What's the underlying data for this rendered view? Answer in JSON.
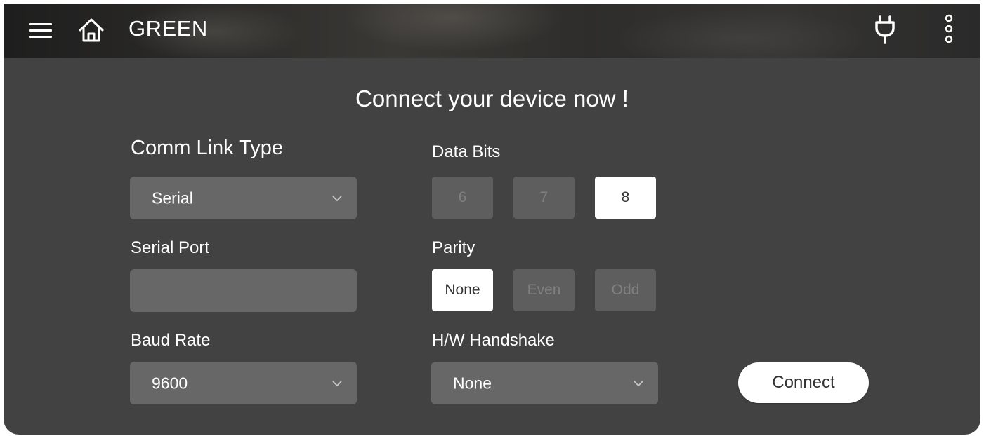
{
  "appbar": {
    "title": "GREEN",
    "icons": [
      "menu-icon",
      "home-icon",
      "plug-icon",
      "more-vert-icon"
    ]
  },
  "heading": "Connect your device now !",
  "comm_link": {
    "label": "Comm Link Type",
    "value": "Serial"
  },
  "serial_port": {
    "label": "Serial Port",
    "value": ""
  },
  "baud_rate": {
    "label": "Baud Rate",
    "value": "9600"
  },
  "data_bits": {
    "label": "Data Bits",
    "options": [
      "6",
      "7",
      "8"
    ],
    "selected": "8"
  },
  "parity": {
    "label": "Parity",
    "options": [
      "None",
      "Even",
      "Odd"
    ],
    "selected": "None"
  },
  "handshake": {
    "label": "H/W Handshake",
    "value": "None"
  },
  "connect_label": "Connect",
  "colors": {
    "panel": "#424242",
    "control": "#676767",
    "selected": "#ffffff"
  }
}
